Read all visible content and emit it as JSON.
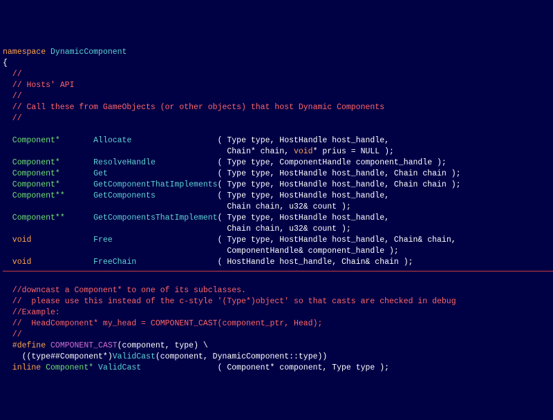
{
  "l1a": "namespace",
  "l1b": " DynamicComponent",
  "l2": "{",
  "c1": "  //",
  "c2": "  // Hosts' API",
  "c3": "  //",
  "c4": "  // Call these from GameObjects (or other objects) that host Dynamic Components",
  "c5": "  //",
  "r1t": "  Component*",
  "r1n": "       Allocate",
  "r1s": "                  ( Type type, HostHandle host_handle,",
  "r1s2": "                                               Chain* chain, ",
  "r1k": "void",
  "r1s3": "* prius = NULL );",
  "r2t": "  Component*",
  "r2n": "       ResolveHandle",
  "r2s": "             ( Type type, ComponentHandle component_handle );",
  "r3t": "  Component*",
  "r3n": "       Get",
  "r3s": "                       ( Type type, HostHandle host_handle, Chain chain );",
  "r4t": "  Component*",
  "r4n": "       GetComponentThatImplements",
  "r4s": "( Type type, HostHandle host_handle, Chain chain );",
  "r5t": "  Component**",
  "r5n": "      GetComponents",
  "r5s": "             ( Type type, HostHandle host_handle,",
  "r5s2": "                                               Chain chain, u32& count );",
  "r6t": "  Component**",
  "r6n": "      GetComponentsThatImplement",
  "r6s": "( Type type, HostHandle host_handle,",
  "r6s2": "                                               Chain chain, u32& count );",
  "r7k": "  void",
  "r7n": "             Free",
  "r7s": "                      ( Type type, HostHandle host_handle, Chain& chain,",
  "r7s2": "                                               ComponentHandle& component_handle );",
  "r8k": "  void",
  "r8n": "             FreeChain",
  "r8s": "                 ( HostHandle host_handle, Chain& chain );",
  "d1": "  //downcast a Component* to one of its subclasses.",
  "d2": "  //  please use this instead of the c-style '(Type*)object' so that casts are checked in debug",
  "d3": "  //Example:",
  "d4": "  //  HeadComponent* my_head = COMPONENT_CAST(component_ptr, Head);",
  "d5": "  //",
  "m1a": "  #define",
  "m1b": " COMPONENT_CAST",
  "m1c": "(component, type) \\",
  "m2a": "    ((type##Component*)",
  "m2b": "ValidCast",
  "m2c": "(component, DynamicComponent::type))",
  "m3a": "  inline",
  "m3b": " Component*",
  "m3c": " ValidCast",
  "m3d": "                ( Component* component, Type type );"
}
